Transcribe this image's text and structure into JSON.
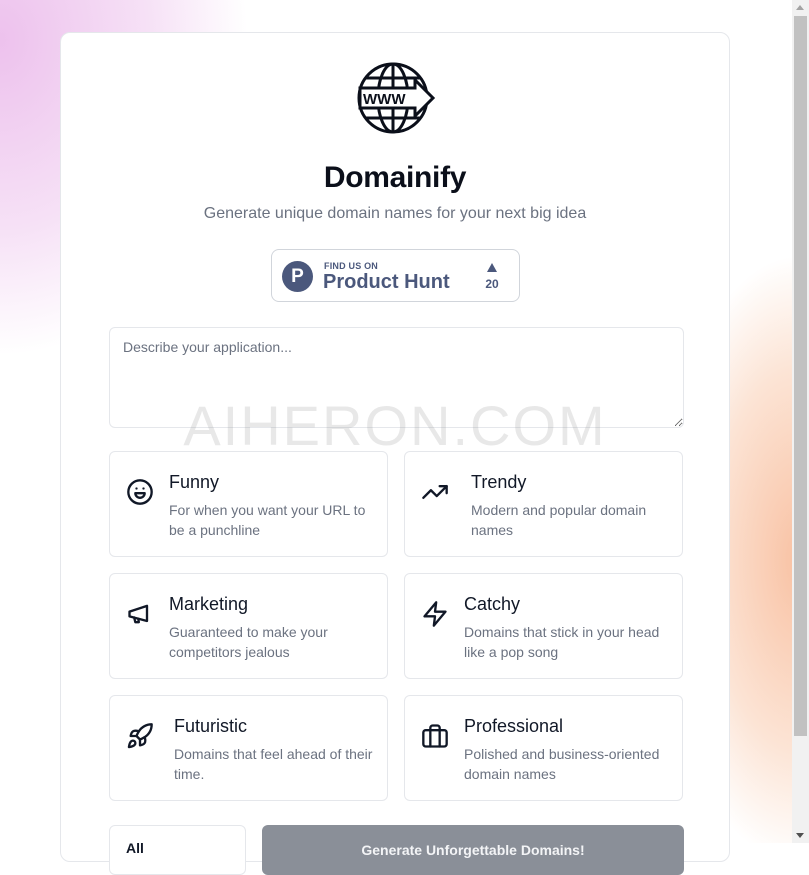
{
  "app": {
    "title": "Domainify",
    "subtitle": "Generate unique domain names for your next big idea",
    "logo_icon": "globe-www-arrow-icon",
    "logo_text": "WWW"
  },
  "product_hunt": {
    "eyebrow": "FIND US ON",
    "name": "Product Hunt",
    "upvotes": "20",
    "logo_letter": "P",
    "color": "#4b587c"
  },
  "description": {
    "placeholder": "Describe your application...",
    "value": ""
  },
  "watermark": "AIHERON.COM",
  "options": [
    {
      "title": "Funny",
      "description": "For when you want your URL to be a punchline",
      "icon": "smile-icon"
    },
    {
      "title": "Trendy",
      "description": "Modern and popular domain names",
      "icon": "trending-up-icon"
    },
    {
      "title": "Marketing",
      "description": "Guaranteed to make your competitors jealous",
      "icon": "megaphone-icon"
    },
    {
      "title": "Catchy",
      "description": "Domains that stick in your head like a pop song",
      "icon": "zap-icon"
    },
    {
      "title": "Futuristic",
      "description": "Domains that feel ahead of their time.",
      "icon": "rocket-icon"
    },
    {
      "title": "Professional",
      "description": "Polished and business-oriented domain names",
      "icon": "briefcase-icon"
    }
  ],
  "controls": {
    "select_value": "All",
    "generate_label": "Generate Unforgettable Domains!"
  },
  "colors": {
    "button_bg": "#8a8f98",
    "text": "#111827",
    "muted": "#6b7280"
  }
}
